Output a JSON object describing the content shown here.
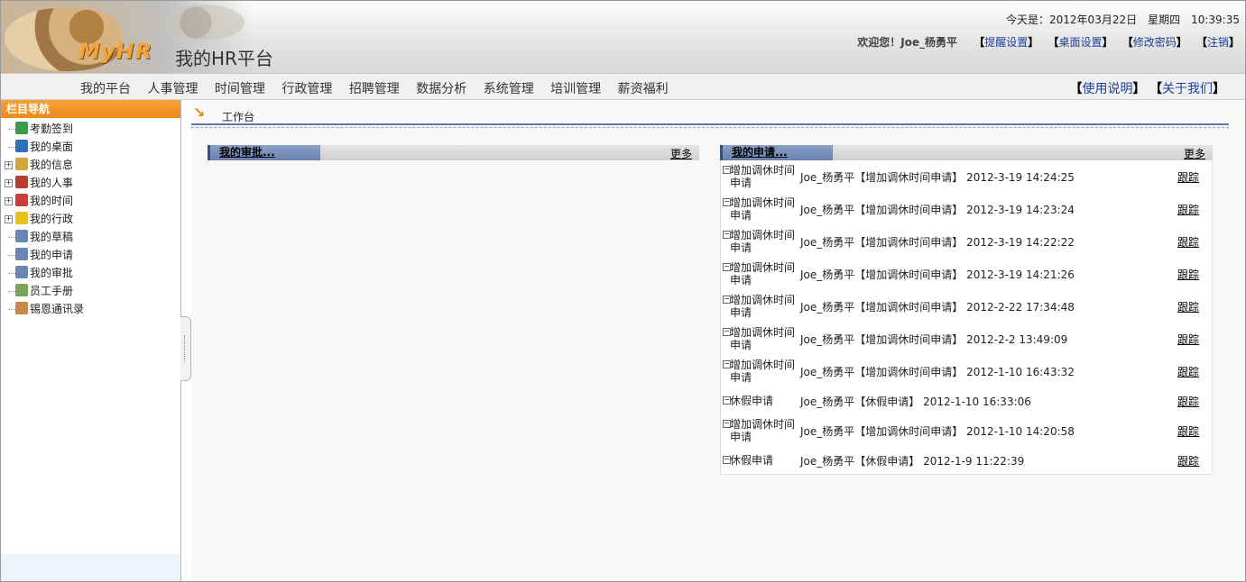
{
  "header": {
    "logo_text": "MyHR",
    "site_title": "我的HR平台",
    "date_label": "今天是：2012年03月22日　星期四　10:39:35",
    "welcome": "欢迎您！Joe_杨勇平",
    "links": [
      "提醒设置",
      "桌面设置",
      "修改密码",
      "注销"
    ]
  },
  "menu": {
    "items": [
      "我的平台",
      "人事管理",
      "时间管理",
      "行政管理",
      "招聘管理",
      "数据分析",
      "系统管理",
      "培训管理",
      "薪资福利"
    ],
    "right": [
      "使用说明",
      "关于我们"
    ]
  },
  "sidebar": {
    "title": "栏目导航",
    "items": [
      {
        "label": "考勤签到",
        "icon": "check-icon",
        "color": "#3a9c4a",
        "expandable": false
      },
      {
        "label": "我的桌面",
        "icon": "user-globe-icon",
        "color": "#2f6fb8",
        "expandable": false
      },
      {
        "label": "我的信息",
        "icon": "folder-user-icon",
        "color": "#d6a33a",
        "expandable": true
      },
      {
        "label": "我的人事",
        "icon": "book-icon",
        "color": "#b3402f",
        "expandable": true
      },
      {
        "label": "我的时间",
        "icon": "calendar-icon",
        "color": "#c8403a",
        "expandable": true
      },
      {
        "label": "我的行政",
        "icon": "star-icon",
        "color": "#e8c21a",
        "expandable": true
      },
      {
        "label": "我的草稿",
        "icon": "document-icon",
        "color": "#6a86b4",
        "expandable": false
      },
      {
        "label": "我的申请",
        "icon": "document-icon",
        "color": "#6a86b4",
        "expandable": false
      },
      {
        "label": "我的审批",
        "icon": "document-icon",
        "color": "#6a86b4",
        "expandable": false
      },
      {
        "label": "员工手册",
        "icon": "pen-icon",
        "color": "#7aa25a",
        "expandable": false
      },
      {
        "label": "锡恩通讯录",
        "icon": "address-book-icon",
        "color": "#c88a4a",
        "expandable": false
      }
    ]
  },
  "breadcrumb": "工作台",
  "approvals": {
    "title": "我的审批...",
    "more": "更多"
  },
  "applications": {
    "title": "我的申请...",
    "more": "更多",
    "track_label": "跟踪",
    "rows": [
      {
        "type": "增加调休时间申请",
        "summary": "Joe_杨勇平【增加调休时间申请】 2012-3-19 14:24:25"
      },
      {
        "type": "增加调休时间申请",
        "summary": "Joe_杨勇平【增加调休时间申请】 2012-3-19 14:23:24"
      },
      {
        "type": "增加调休时间申请",
        "summary": "Joe_杨勇平【增加调休时间申请】 2012-3-19 14:22:22"
      },
      {
        "type": "增加调休时间申请",
        "summary": "Joe_杨勇平【增加调休时间申请】 2012-3-19 14:21:26"
      },
      {
        "type": "增加调休时间申请",
        "summary": "Joe_杨勇平【增加调休时间申请】 2012-2-22 17:34:48"
      },
      {
        "type": "增加调休时间申请",
        "summary": "Joe_杨勇平【增加调休时间申请】 2012-2-2 13:49:09"
      },
      {
        "type": "增加调休时间申请",
        "summary": "Joe_杨勇平【增加调休时间申请】 2012-1-10 16:43:32"
      },
      {
        "type": "休假申请",
        "summary": "Joe_杨勇平【休假申请】 2012-1-10 16:33:06"
      },
      {
        "type": "增加调休时间申请",
        "summary": "Joe_杨勇平【增加调休时间申请】 2012-1-10 14:20:58"
      },
      {
        "type": "休假申请",
        "summary": "Joe_杨勇平【休假申请】 2012-1-9 11:22:39"
      }
    ]
  }
}
